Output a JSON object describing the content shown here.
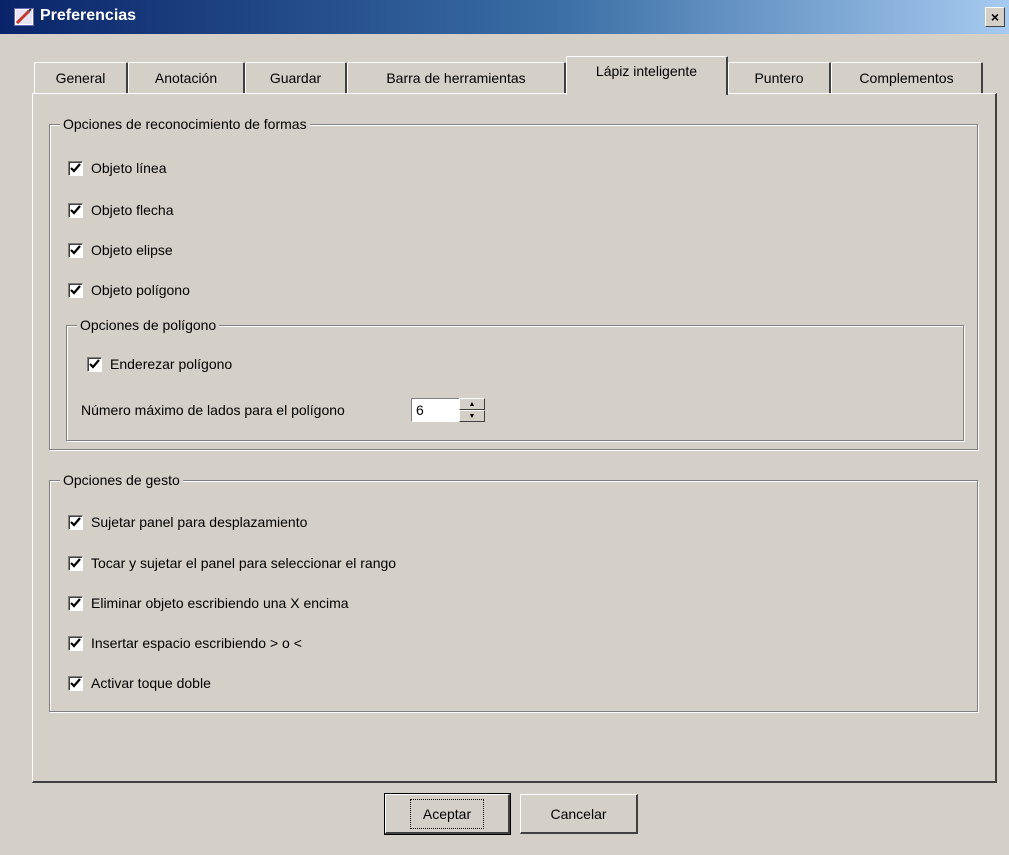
{
  "window": {
    "title": "Preferencias",
    "close_glyph": "×",
    "icon": "app-icon"
  },
  "tabs": [
    {
      "label": "General",
      "active": false
    },
    {
      "label": "Anotación",
      "active": false
    },
    {
      "label": "Guardar",
      "active": false
    },
    {
      "label": "Barra de herramientas",
      "active": false
    },
    {
      "label": "Lápiz inteligente",
      "active": true
    },
    {
      "label": "Puntero",
      "active": false
    },
    {
      "label": "Complementos",
      "active": false
    }
  ],
  "shape_recognition": {
    "title": "Opciones de reconocimiento de formas",
    "options": [
      {
        "label": "Objeto línea",
        "checked": true
      },
      {
        "label": "Objeto flecha",
        "checked": true
      },
      {
        "label": "Objeto elipse",
        "checked": true
      },
      {
        "label": "Objeto polígono",
        "checked": true
      }
    ],
    "polygon": {
      "title": "Opciones de polígono",
      "straighten": {
        "label": "Enderezar polígono",
        "checked": true
      },
      "max_sides_label": "Número máximo de lados para el polígono",
      "max_sides_value": "6"
    }
  },
  "gesture": {
    "title": "Opciones de gesto",
    "options": [
      {
        "label": "Sujetar panel para desplazamiento",
        "checked": true
      },
      {
        "label": "Tocar y sujetar el panel para seleccionar el rango",
        "checked": true
      },
      {
        "label": "Eliminar objeto escribiendo una X encima",
        "checked": true
      },
      {
        "label": "Insertar espacio escribiendo > o <",
        "checked": true
      },
      {
        "label": "Activar toque doble",
        "checked": true
      }
    ]
  },
  "buttons": {
    "ok": "Aceptar",
    "cancel": "Cancelar"
  }
}
